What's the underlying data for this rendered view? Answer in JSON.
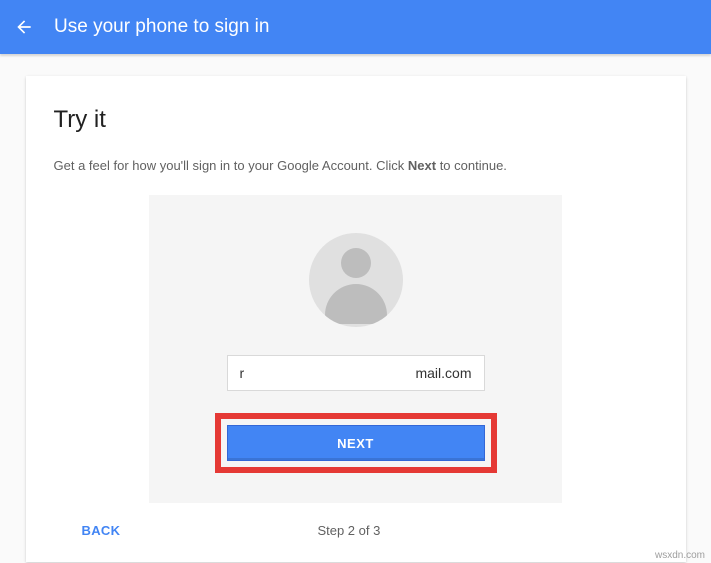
{
  "header": {
    "title": "Use your phone to sign in"
  },
  "card": {
    "title": "Try it",
    "subtitle_prefix": "Get a feel for how you'll sign in to your Google Account. Click ",
    "subtitle_bold": "Next",
    "subtitle_suffix": " to continue."
  },
  "signin_preview": {
    "email_left": "r",
    "email_right": "mail.com",
    "next_button_label": "NEXT"
  },
  "footer": {
    "back_label": "BACK",
    "step_label": "Step 2 of 3"
  },
  "watermark": "wsxdn.com"
}
